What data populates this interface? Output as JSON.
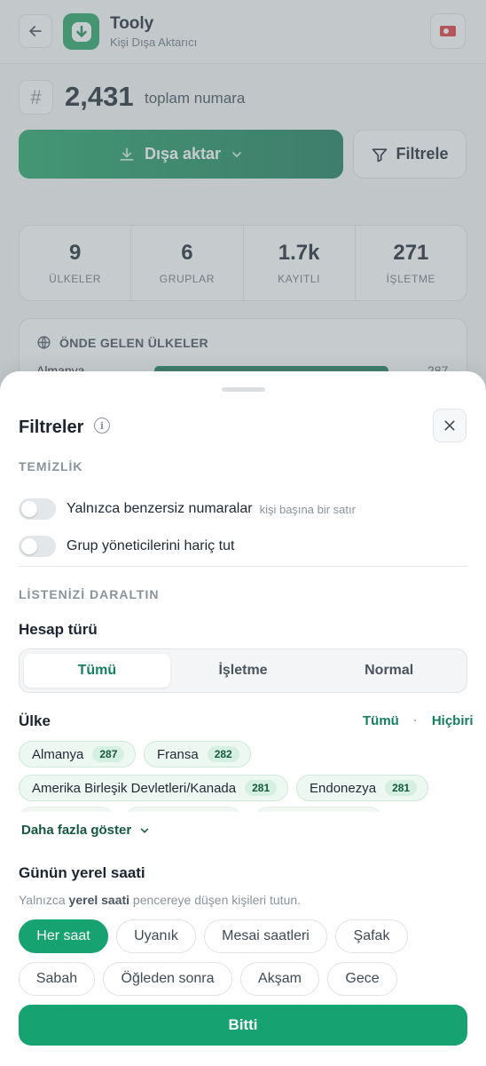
{
  "header": {
    "title": "Tooly",
    "subtitle": "Kişi Dışa Aktarıcı",
    "flag": "tr"
  },
  "summary": {
    "count": "2,431",
    "label": "toplam numara",
    "hash": "#"
  },
  "actions": {
    "export_label": "Dışa aktar",
    "filter_label": "Filtrele"
  },
  "stats": [
    {
      "value": "9",
      "label": "ÜLKELER"
    },
    {
      "value": "6",
      "label": "GRUPLAR"
    },
    {
      "value": "1.7k",
      "label": "KAYITLI"
    },
    {
      "value": "271",
      "label": "İŞLETME"
    }
  ],
  "top_countries": {
    "title": "ÖNDE GELEN ÜLKELER",
    "rows": [
      {
        "name": "Almanya",
        "value": "287"
      }
    ]
  },
  "filters": {
    "title": "Filtreler",
    "cleanup": {
      "label": "TEMİZLİK",
      "unique_label": "Yalnızca benzersiz numaralar",
      "unique_hint": "kişi başına bir satır",
      "exclude_admins_label": "Grup yöneticilerini hariç tut"
    },
    "narrow": {
      "label": "LİSTENİZİ DARALTIN",
      "account_type_label": "Hesap türü",
      "account_types": [
        "Tümü",
        "İşletme",
        "Normal"
      ],
      "country_label": "Ülke",
      "country_all": "Tümü",
      "country_none": "Hiçbiri",
      "countries": [
        {
          "name": "Almanya",
          "count": "287"
        },
        {
          "name": "Fransa",
          "count": "282"
        },
        {
          "name": "Amerika Birleşik Devletleri/Kanada",
          "count": "281"
        },
        {
          "name": "Endonezya",
          "count": "281"
        }
      ],
      "show_more": "Daha fazla göster"
    },
    "local_time": {
      "label": "Günün yerel saati",
      "desc_prefix": "Yalnızca ",
      "desc_bold": "yerel saati",
      "desc_suffix": " pencereye düşen kişileri tutun.",
      "options": [
        "Her saat",
        "Uyanık",
        "Mesai saatleri",
        "Şafak",
        "Sabah",
        "Öğleden sonra",
        "Akşam",
        "Gece"
      ]
    },
    "done_label": "Bitti"
  }
}
